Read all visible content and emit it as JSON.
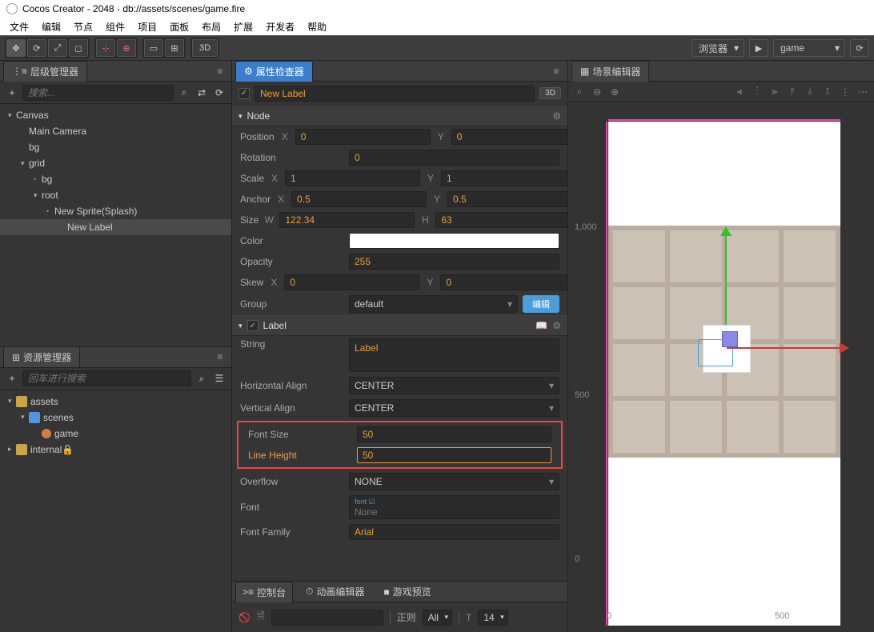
{
  "window": {
    "title": "Cocos Creator - 2048 - db://assets/scenes/game.fire"
  },
  "menu": [
    "文件",
    "编辑",
    "节点",
    "组件",
    "项目",
    "面板",
    "布局",
    "扩展",
    "开发者",
    "帮助"
  ],
  "toolbar": {
    "mode_3d": "3D",
    "preview_mode": "浏览器",
    "scene_select": "game"
  },
  "panels": {
    "hierarchy": "层级管理器",
    "assets": "资源管理器",
    "inspector": "属性检查器",
    "scene": "场景编辑器",
    "console": "控制台",
    "timeline": "动画编辑器",
    "game_preview": "游戏预览"
  },
  "hierarchy": {
    "search_placeholder": "搜索...",
    "tree": [
      {
        "label": "Canvas",
        "depth": 0,
        "caret": "down",
        "sel": false
      },
      {
        "label": "Main Camera",
        "depth": 1,
        "caret": "",
        "sel": false
      },
      {
        "label": "bg",
        "depth": 1,
        "caret": "",
        "sel": false
      },
      {
        "label": "grid",
        "depth": 1,
        "caret": "down",
        "sel": false
      },
      {
        "label": "bg",
        "depth": 2,
        "caret": "dot",
        "sel": false
      },
      {
        "label": "root",
        "depth": 2,
        "caret": "down",
        "sel": false
      },
      {
        "label": "New Sprite(Splash)",
        "depth": 3,
        "caret": "dot",
        "sel": false
      },
      {
        "label": "New Label",
        "depth": 4,
        "caret": "",
        "sel": true
      }
    ]
  },
  "assets": {
    "search_placeholder": "回车进行搜索",
    "tree": [
      {
        "label": "assets",
        "depth": 0,
        "caret": "down",
        "icon": "folder-y"
      },
      {
        "label": "scenes",
        "depth": 1,
        "caret": "down",
        "icon": "folder-b"
      },
      {
        "label": "game",
        "depth": 2,
        "caret": "",
        "icon": "fire"
      },
      {
        "label": "internal",
        "depth": 0,
        "caret": "right",
        "icon": "folder-y",
        "lock": true
      }
    ]
  },
  "inspector": {
    "node_name": "New Label",
    "badge_3d": "3D",
    "sections": {
      "node": "Node",
      "label": "Label"
    },
    "labels": {
      "position": "Position",
      "rotation": "Rotation",
      "scale": "Scale",
      "anchor": "Anchor",
      "size": "Size",
      "color": "Color",
      "opacity": "Opacity",
      "skew": "Skew",
      "group": "Group",
      "string": "String",
      "h_align": "Horizontal Align",
      "v_align": "Vertical Align",
      "font_size": "Font Size",
      "line_height": "Line Height",
      "overflow": "Overflow",
      "font": "Font",
      "font_family": "Font Family",
      "edit": "编辑"
    },
    "values": {
      "pos_x": "0",
      "pos_y": "0",
      "rotation": "0",
      "scale_x": "1",
      "scale_y": "1",
      "anchor_x": "0.5",
      "anchor_y": "0.5",
      "size_w": "122.34",
      "size_h": "63",
      "opacity": "255",
      "skew_x": "0",
      "skew_y": "0",
      "group": "default",
      "string": "Label",
      "h_align": "CENTER",
      "v_align": "CENTER",
      "font_size": "50",
      "line_height": "50",
      "overflow": "NONE",
      "font_tag": "font ☑",
      "font_none": "None",
      "font_family": "Arial"
    },
    "axis": {
      "x": "X",
      "y": "Y",
      "w": "W",
      "h": "H"
    }
  },
  "scene": {
    "ruler_y": [
      "1,000",
      "500",
      "0"
    ],
    "ruler_x": [
      "0",
      "500"
    ]
  },
  "console": {
    "regex": "正则",
    "all": "All",
    "font_size": "14"
  }
}
